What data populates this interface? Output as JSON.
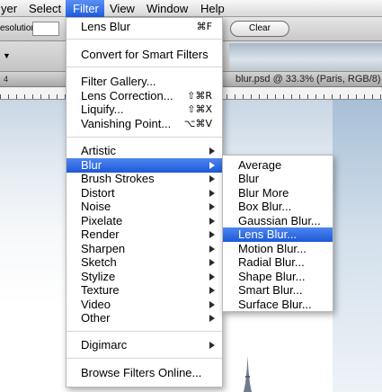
{
  "menubar": {
    "items": [
      "yer",
      "Select",
      "Filter",
      "View",
      "Window",
      "Help"
    ]
  },
  "options_bar": {
    "resolution_label": "esolution:",
    "clear_label": "Clear"
  },
  "palette_bar": {
    "dropdown_glyph": "▼"
  },
  "document": {
    "title": "blur.psd @ 33.3% (Paris, RGB/8)",
    "ruler_left_number": "4"
  },
  "filter_menu": {
    "last_filter": {
      "label": "Lens Blur",
      "shortcut": "⌘F"
    },
    "convert_smart": "Convert for Smart Filters",
    "special": [
      {
        "label": "Filter Gallery...",
        "shortcut": ""
      },
      {
        "label": "Lens Correction...",
        "shortcut": "⇧⌘R"
      },
      {
        "label": "Liquify...",
        "shortcut": "⇧⌘X"
      },
      {
        "label": "Vanishing Point...",
        "shortcut": "⌥⌘V"
      }
    ],
    "categories": [
      "Artistic",
      "Blur",
      "Brush Strokes",
      "Distort",
      "Noise",
      "Pixelate",
      "Render",
      "Sharpen",
      "Sketch",
      "Stylize",
      "Texture",
      "Video",
      "Other"
    ],
    "highlighted_category": "Blur",
    "digimarc": "Digimarc",
    "browse_online": "Browse Filters Online..."
  },
  "blur_submenu": {
    "items": [
      "Average",
      "Blur",
      "Blur More",
      "Box Blur...",
      "Gaussian Blur...",
      "Lens Blur...",
      "Motion Blur...",
      "Radial Blur...",
      "Shape Blur...",
      "Smart Blur...",
      "Surface Blur..."
    ],
    "highlighted": "Lens Blur..."
  },
  "colors": {
    "highlight": "#1d58d8",
    "menu_background": "#ffffff"
  }
}
